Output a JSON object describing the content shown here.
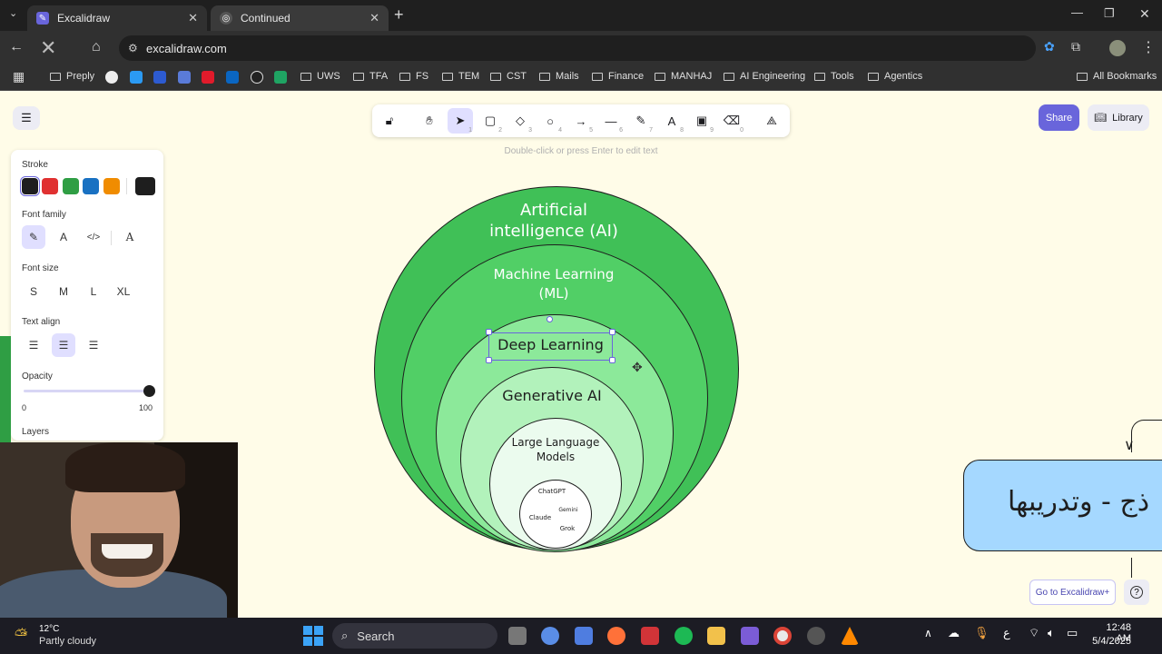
{
  "browser": {
    "tabs": [
      {
        "title": "Excalidraw"
      },
      {
        "title": "Continued"
      }
    ],
    "url": "excalidraw.com",
    "bookmarks": [
      {
        "label": "Preply",
        "type": "site"
      },
      {
        "label": "UWS",
        "type": "folder"
      },
      {
        "label": "TFA",
        "type": "folder"
      },
      {
        "label": "FS",
        "type": "folder"
      },
      {
        "label": "TEM",
        "type": "folder"
      },
      {
        "label": "CST",
        "type": "folder"
      },
      {
        "label": "Mails",
        "type": "folder"
      },
      {
        "label": "Finance",
        "type": "folder"
      },
      {
        "label": "MANHAJ",
        "type": "folder"
      },
      {
        "label": "AI Engineering",
        "type": "folder"
      },
      {
        "label": "Tools",
        "type": "folder"
      },
      {
        "label": "Agentics",
        "type": "folder"
      }
    ],
    "all_bookmarks": "All Bookmarks"
  },
  "excalidraw": {
    "share": "Share",
    "library": "Library",
    "hint": "Double-click or press Enter to edit text",
    "tool_keys": [
      "1",
      "2",
      "3",
      "4",
      "5",
      "6",
      "7",
      "8",
      "9",
      "0"
    ],
    "props": {
      "stroke": "Stroke",
      "stroke_colors": [
        "#1e1e1e",
        "#e03131",
        "#2f9e44",
        "#1971c2",
        "#f08c00"
      ],
      "font_family": "Font family",
      "font_family_sans": "A",
      "font_family_hand": "A",
      "font_family_code": "</>",
      "font_size": "Font size",
      "sizes": [
        "S",
        "M",
        "L",
        "XL"
      ],
      "text_align": "Text align",
      "opacity": "Opacity",
      "opacity_min": "0",
      "opacity_max": "100",
      "layers": "Layers"
    },
    "diagram": {
      "ai": "Artificial intelligence (AI)",
      "ml": "Machine Learning (ML)",
      "dl": "Deep Learning",
      "genai": "Generative AI",
      "llm": "Large Language Models",
      "models": [
        "ChatGPT",
        "Gemini",
        "Claude",
        "Grok"
      ]
    },
    "arabic_box": "ذج - وتدريبها",
    "go_plus": "Go to Excalidraw+",
    "help": "?"
  },
  "taskbar": {
    "temp": "12°C",
    "weather": "Partly cloudy",
    "search": "Search",
    "lang": "ع",
    "time": "12:48 AM",
    "date": "5/4/2025"
  }
}
